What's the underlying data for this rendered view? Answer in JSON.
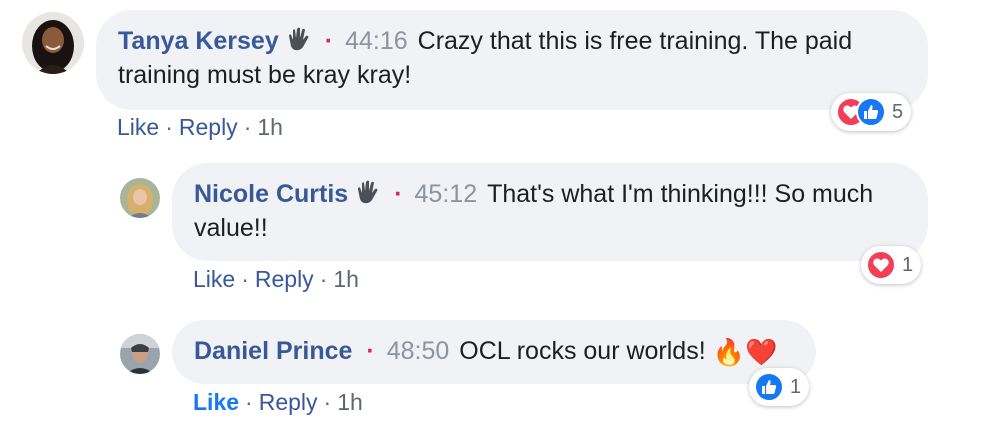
{
  "comments": [
    {
      "author": "Tanya Kersey",
      "timestamp": "44:16",
      "text_line1": "Crazy that this is free training. The paid",
      "text_line2": "training must be kray kray!",
      "actions": {
        "like": "Like",
        "reply": "Reply",
        "age": "1h"
      },
      "reactions": {
        "icons": [
          "heart",
          "like"
        ],
        "count": "5"
      }
    },
    {
      "author": "Nicole Curtis",
      "timestamp": "45:12",
      "text_line1": "That's what I'm thinking!!! So much",
      "text_line2": "value!!",
      "actions": {
        "like": "Like",
        "reply": "Reply",
        "age": "1h"
      },
      "reactions": {
        "icons": [
          "heart"
        ],
        "count": "1"
      }
    },
    {
      "author": "Daniel Prince",
      "timestamp": "48:50",
      "text_line1": "OCL rocks our worlds!",
      "emojis": "🔥❤️",
      "actions": {
        "like": "Like",
        "reply": "Reply",
        "age": "1h",
        "like_active": true
      },
      "reactions": {
        "icons": [
          "like"
        ],
        "count": "1"
      }
    }
  ],
  "separator": "·",
  "colors": {
    "author": "#385898",
    "like_active": "#1877f2",
    "bubble_bg": "#f0f2f5",
    "heart": "#f33e58",
    "like_icon": "#1877f2",
    "time": "#8d949e"
  }
}
